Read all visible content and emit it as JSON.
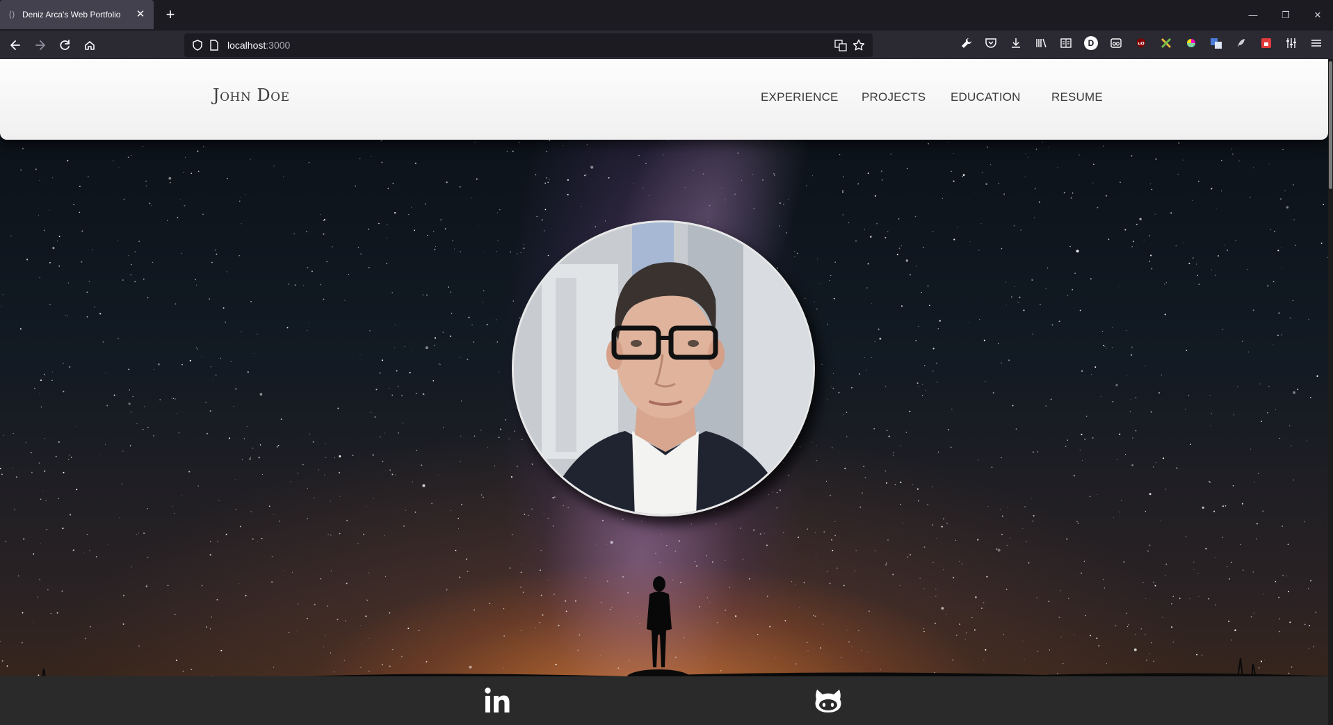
{
  "browser": {
    "tab_title": "Deniz Arca's Web Portfolio",
    "tab_close": "✕",
    "new_tab": "+",
    "url_host": "localhost",
    "url_port": ":3000",
    "window": {
      "minimize": "—",
      "restore": "❐",
      "close": "✕"
    },
    "nav_icons": [
      "back-arrow-icon",
      "forward-arrow-icon",
      "reload-icon",
      "home-icon"
    ],
    "toolbar_icons": [
      "wrench-icon",
      "pocket-icon",
      "download-icon",
      "library-icon",
      "reader-view-icon",
      "extension-d-icon",
      "extension-glasses-icon",
      "ublock-icon",
      "extension-x-icon",
      "color-picker-icon",
      "translate-icon",
      "feather-icon",
      "extension-red-icon",
      "sliders-icon",
      "menu-icon"
    ]
  },
  "site": {
    "brand": "John Doe",
    "nav": [
      "EXPERIENCE",
      "PROJECTS",
      "EDUCATION",
      "RESUME"
    ],
    "social": [
      "linkedin-icon",
      "github-icon"
    ]
  },
  "colors": {
    "header_bg": "#f5f5f5",
    "footer_bg": "#2a2a2a",
    "browser_bg": "#1c1b22",
    "urlbar_bg": "#2b2a33"
  }
}
